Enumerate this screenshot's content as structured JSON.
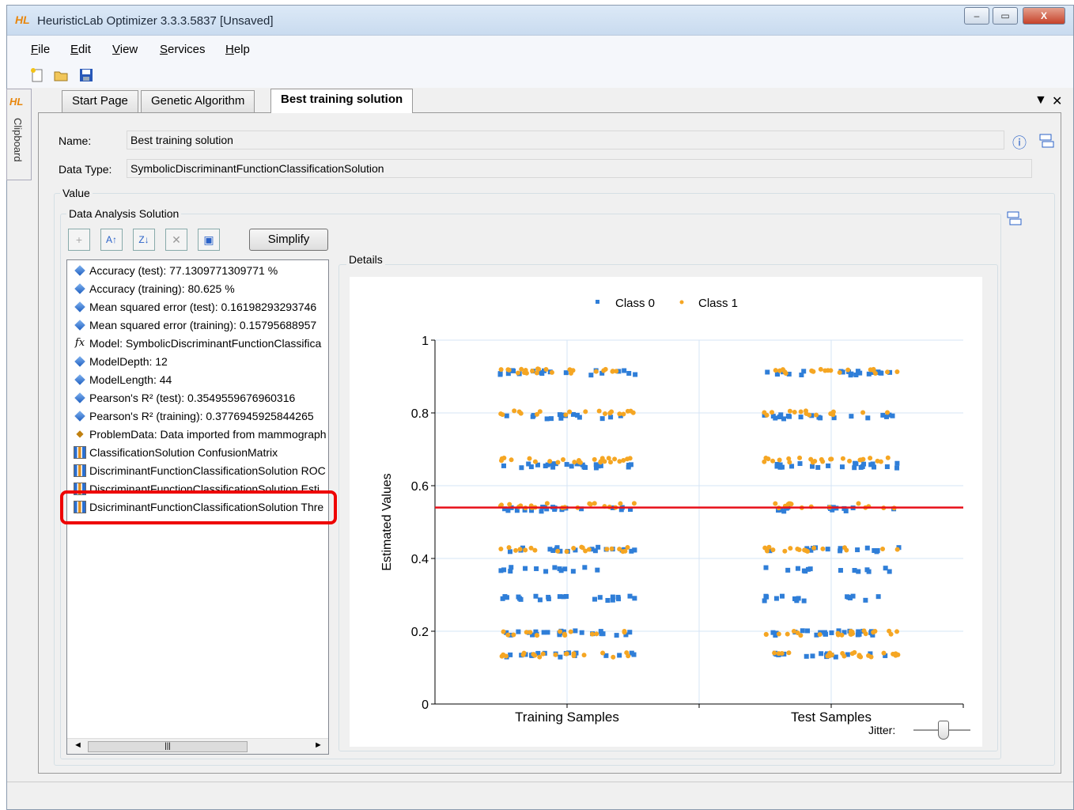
{
  "window": {
    "app_icon": "HL",
    "title": "HeuristicLab Optimizer 3.3.3.5837 [Unsaved]",
    "min_btn": "‒",
    "max_btn": "▭",
    "close_btn": "X"
  },
  "menu": [
    "File",
    "Edit",
    "View",
    "Services",
    "Help"
  ],
  "toolbar_icons": [
    "new-icon",
    "open-icon",
    "save-icon"
  ],
  "sidebar": {
    "logo": "HL",
    "clipboard_label": "Clipboard"
  },
  "tabs": [
    {
      "label": "Start Page"
    },
    {
      "label": "Genetic Algorithm"
    },
    {
      "label": "Best training solution",
      "active": true
    }
  ],
  "tab_controls": {
    "dropdown": "▼",
    "close": "✕"
  },
  "form": {
    "name_label": "Name:",
    "name_value": "Best training solution",
    "datatype_label": "Data Type:",
    "datatype_value": "SymbolicDiscriminantFunctionClassificationSolution",
    "info_icon": "ⓘ"
  },
  "value_group": {
    "title": "Value"
  },
  "das_group": {
    "title": "Data Analysis Solution"
  },
  "buttons": {
    "add": "+",
    "sort_asc": "A↑",
    "sort_desc": "Z↓",
    "remove": "✕",
    "properties": "▣",
    "simplify": "Simplify"
  },
  "items": [
    {
      "icon": "gem",
      "text": "Accuracy (test): 77.1309771309771 %"
    },
    {
      "icon": "gem",
      "text": "Accuracy (training): 80.625 %"
    },
    {
      "icon": "gem",
      "text": "Mean squared error (test): 0.16198293293746"
    },
    {
      "icon": "gem",
      "text": "Mean squared error (training): 0.15795688957"
    },
    {
      "icon": "fx",
      "text": "Model: SymbolicDiscriminantFunctionClassifica"
    },
    {
      "icon": "gem",
      "text": "ModelDepth: 12"
    },
    {
      "icon": "gem",
      "text": "ModelLength: 44"
    },
    {
      "icon": "gem",
      "text": "Pearson's R² (test): 0.3549559676960316"
    },
    {
      "icon": "gem",
      "text": "Pearson's R² (training): 0.3776945925844265"
    },
    {
      "icon": "problem",
      "text": "ProblemData: Data imported from mammograph"
    },
    {
      "icon": "chart",
      "text": "ClassificationSolution ConfusionMatrix"
    },
    {
      "icon": "chart",
      "text": "DiscriminantFunctionClassificationSolution ROC"
    },
    {
      "icon": "chart",
      "text": "DiscriminantFunctionClassificationSolution Esti"
    },
    {
      "icon": "chart",
      "text": "DsicriminantFunctionClassificationSolution Thre"
    }
  ],
  "scroll": {
    "left": "◄",
    "thumb": "|||",
    "right": "►"
  },
  "details": {
    "title": "Details",
    "jitter_label": "Jitter:"
  },
  "chart_data": {
    "type": "scatter",
    "categories": [
      "Training Samples",
      "Test Samples"
    ],
    "ylabel": "Estimated Values",
    "xlabel": "",
    "ylim": [
      0,
      1
    ],
    "yticks": [
      0,
      0.2,
      0.4,
      0.6,
      0.8,
      1
    ],
    "legend_position": "top",
    "threshold": 0.54,
    "threshold_color": "#e8101a",
    "grid": true,
    "series": [
      {
        "name": "Class 0",
        "color": "#2f7ed8",
        "levels": [
          0.135,
          0.195,
          0.29,
          0.37,
          0.425,
          0.535,
          0.655,
          0.79,
          0.91
        ]
      },
      {
        "name": "Class 1",
        "color": "#f5a623",
        "levels": [
          0.135,
          0.195,
          0.425,
          0.545,
          0.67,
          0.8,
          0.915
        ]
      }
    ]
  },
  "colors": {
    "highlight": "#ee0000",
    "accent": "#e8860c"
  }
}
